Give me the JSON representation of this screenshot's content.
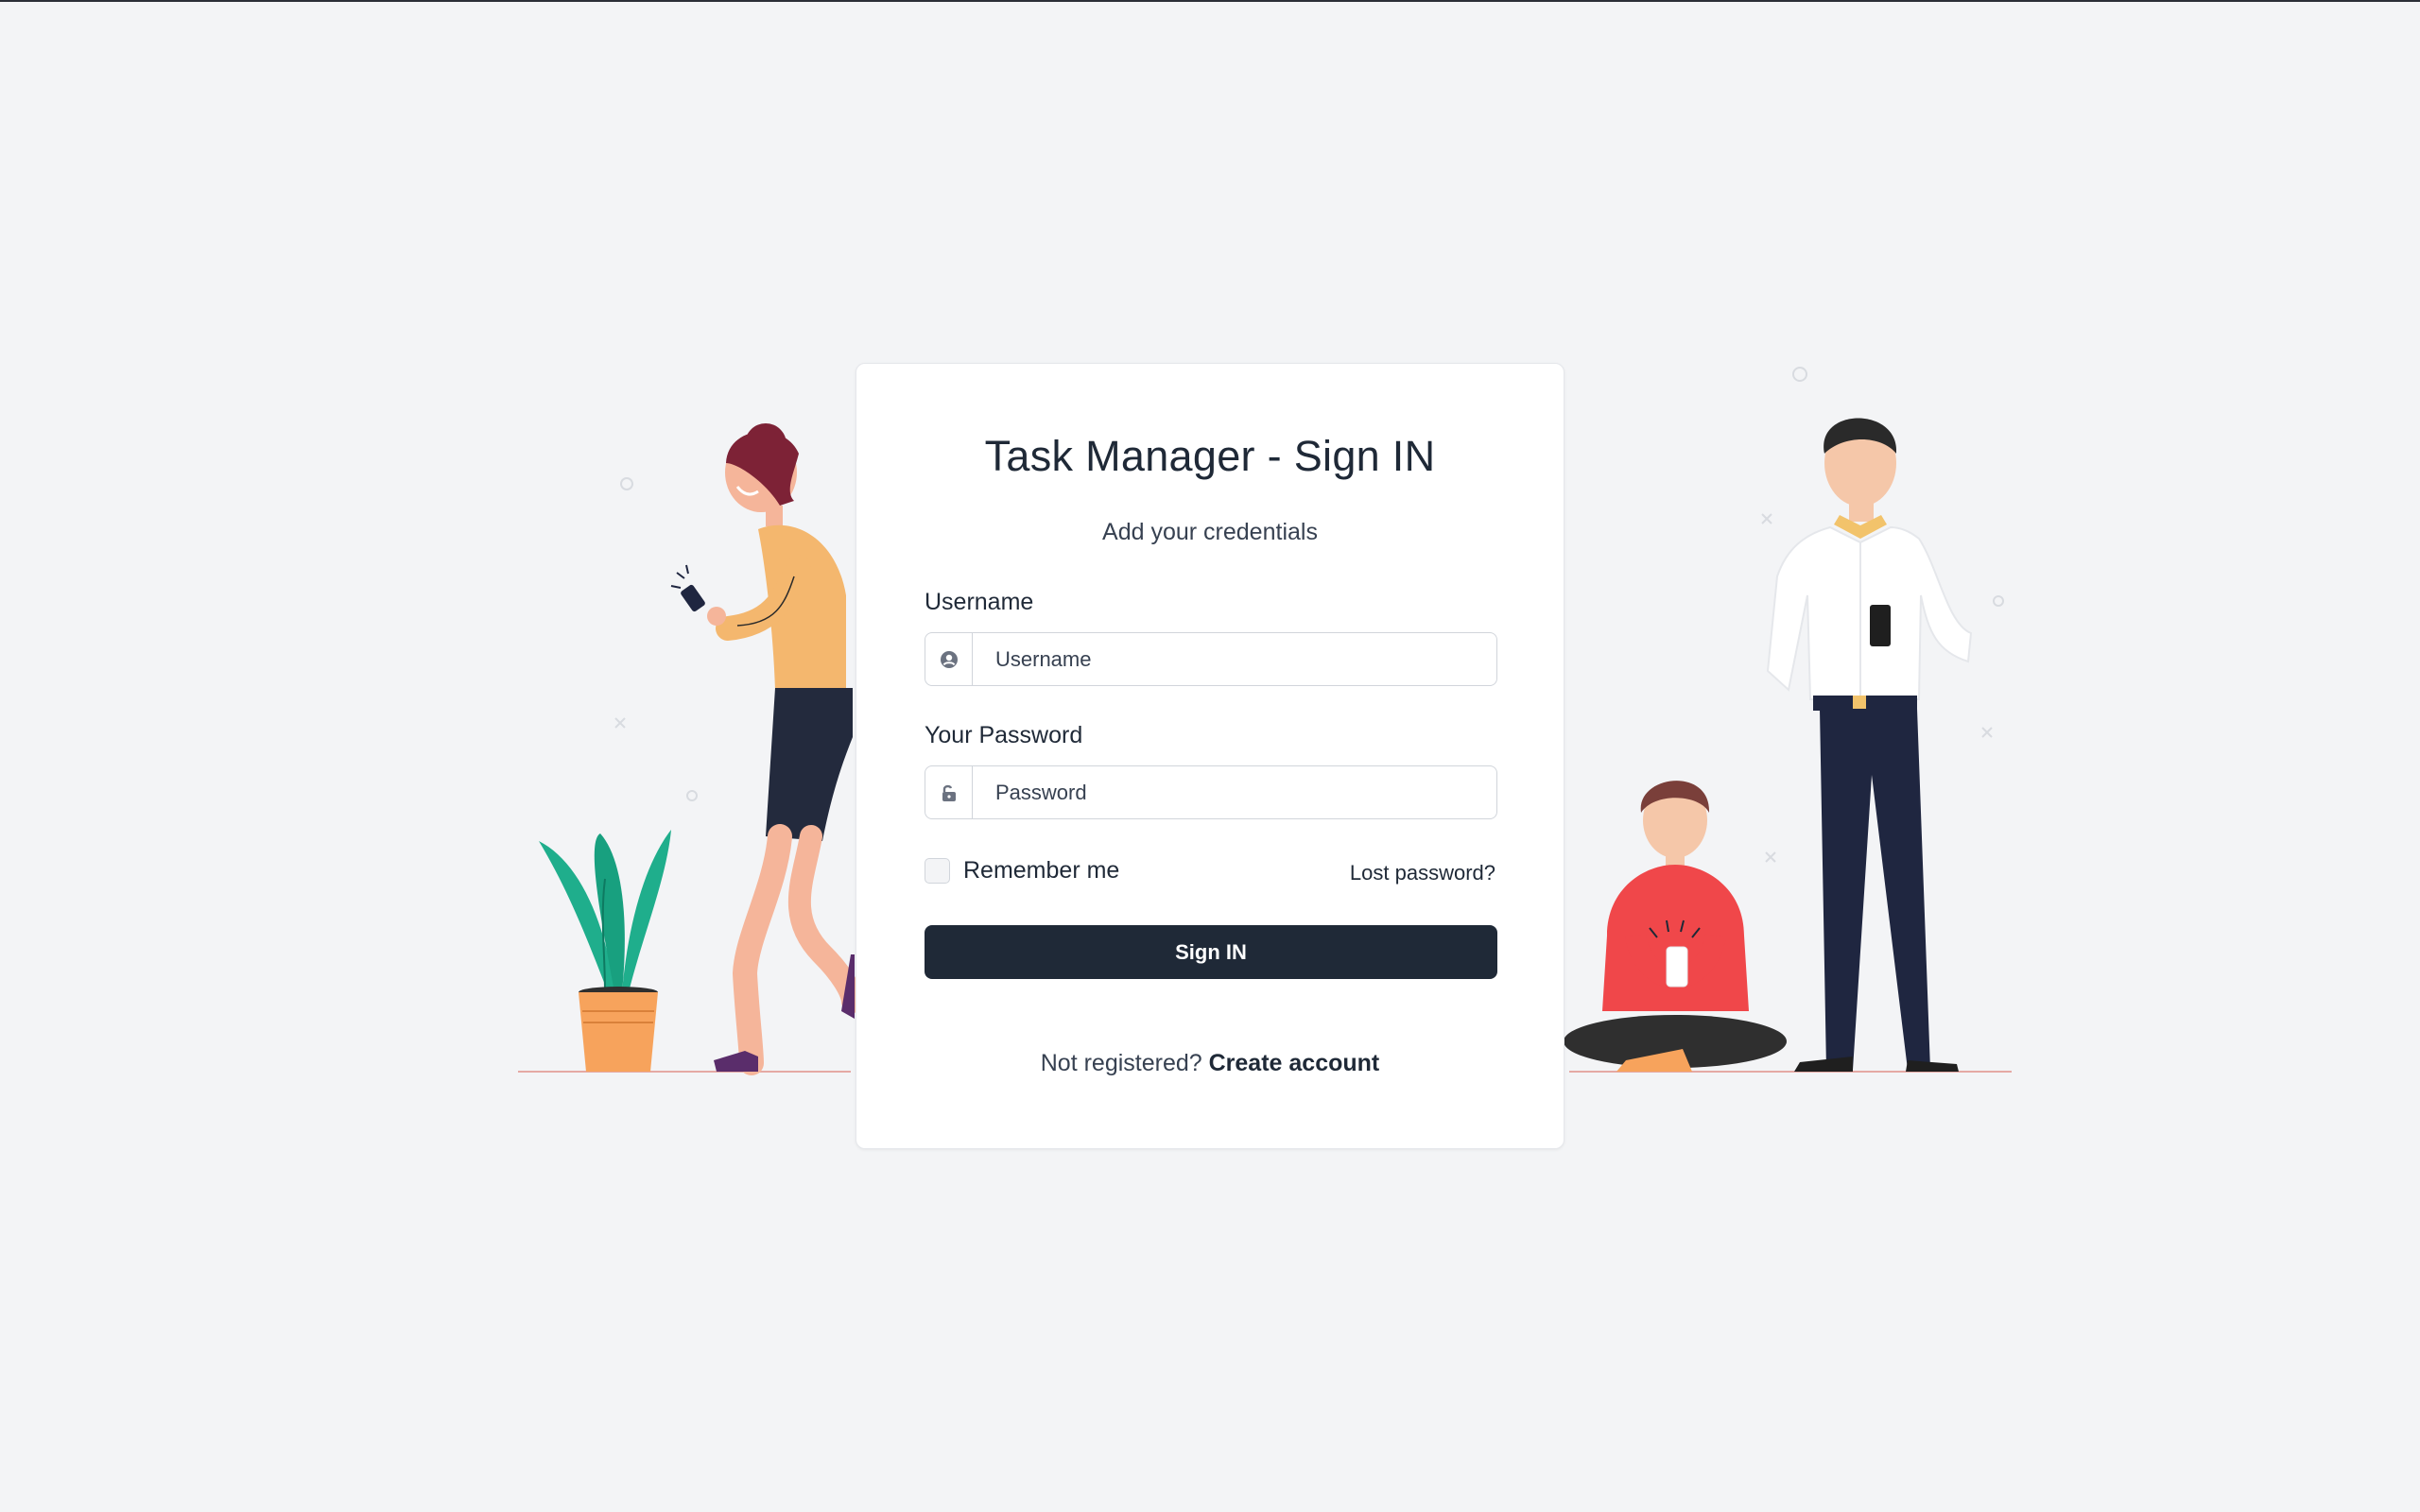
{
  "form": {
    "title": "Task Manager - Sign IN",
    "subtitle": "Add your credentials",
    "username_label": "Username",
    "username_placeholder": "Username",
    "password_label": "Your Password",
    "password_placeholder": "Password",
    "remember_label": "Remember me",
    "remember_checked": false,
    "lost_password_label": "Lost password?",
    "submit_label": "Sign IN",
    "register_prompt": "Not registered?",
    "register_link": "Create account"
  },
  "icons": {
    "username": "user-circle-icon",
    "password": "unlock-icon"
  },
  "colors": {
    "background": "#f3f4f6",
    "card": "#ffffff",
    "primary_button": "#1f2937",
    "plant_leaves": "#1fae8c",
    "plant_pot": "#f7a35c",
    "woman_top": "#f4b76e",
    "boy_sweater": "#f0474a",
    "man_trousers": "#1f2640"
  }
}
